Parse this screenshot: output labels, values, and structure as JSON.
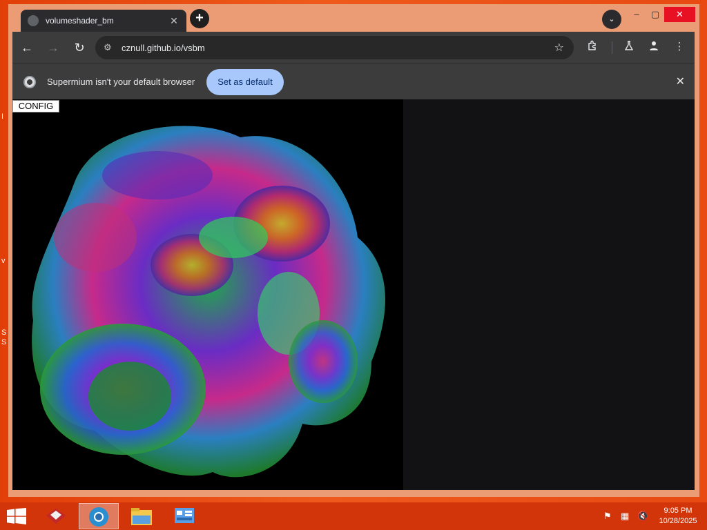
{
  "browser": {
    "tab": {
      "title": "volumeshader_bm"
    },
    "new_tab_symbol": "+",
    "tab_search_symbol": "⌄",
    "window_controls": {
      "minimize": "–",
      "maximize": "▢",
      "close": "✕"
    },
    "toolbar": {
      "back": "←",
      "forward": "→",
      "reload": "↻",
      "url": "cznull.github.io/vsbm",
      "bookmark_icon": "☆",
      "extensions_icon": "puzzle-icon",
      "labs_icon": "flask-icon",
      "profile_icon": "person-icon",
      "menu": "⋮"
    },
    "infobar": {
      "message": "Supermium isn't your default browser",
      "button": "Set as default",
      "close": "✕"
    }
  },
  "page": {
    "config_button": "CONFIG"
  },
  "desktop": {
    "edge_text": [
      "I",
      "v",
      "S",
      "S"
    ]
  },
  "taskbar": {
    "clock": {
      "time": "9:05 PM",
      "date": "10/28/2025"
    },
    "apps": [
      "toolbox-icon",
      "browser-icon",
      "file-explorer-icon",
      "control-panel-icon"
    ],
    "colors": {
      "taskbar": "#d2350a",
      "desktop": "#e8400c"
    }
  }
}
